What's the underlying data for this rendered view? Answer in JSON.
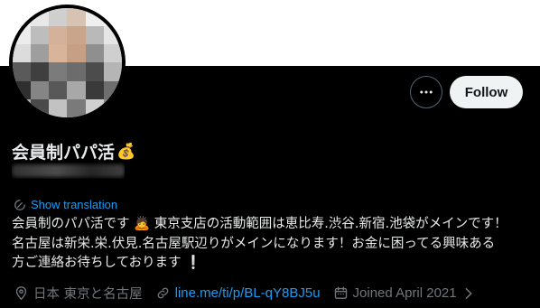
{
  "profile": {
    "display_name": "会員制パパ活",
    "name_emoji": "💰",
    "handle": "",
    "translate_label": "Show translation",
    "bio_lines": [
      "会員制のパパ活です 🙇 東京支店の活動範囲は恵比寿.渋谷.新宿.池袋がメインです！",
      "名古屋は新栄.栄.伏見.名古屋駅辺りがメインになります！お金に困ってる興味ある",
      "方ご連絡お待ちしております ❕"
    ],
    "location": "日本 東京と名古屋",
    "link": "line.me/ti/p/BL-qY8BJ5u",
    "joined": "Joined April 2021"
  },
  "actions": {
    "follow_label": "Follow",
    "more_icon": "more-horizontal-icon"
  },
  "colors": {
    "background": "#000000",
    "banner": "#ffffff",
    "accent": "#1d9bf0",
    "text": "#e7e9ea",
    "muted": "#71767b"
  }
}
